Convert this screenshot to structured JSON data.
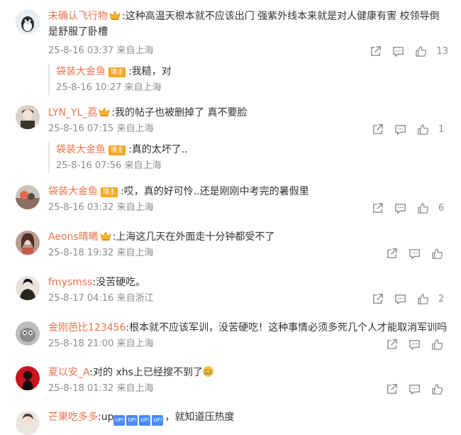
{
  "comments": [
    {
      "username": "未确认飞行物",
      "text": ":这种高温天根本就不应该出门 强紫外线本来就是对人健康有害 校领导倒是舒服了卧槽",
      "meta": "25-8-16 03:37 来自上海",
      "likes": "13",
      "reply": {
        "username": "袋装大金鱼",
        "tag": "博主",
        "text": ":我糙，对",
        "meta": "25-8-16 10:27 来自上海"
      }
    },
    {
      "username": "LYN_YL_荔",
      "text": ":我的帖子也被删掉了 真不要脸",
      "meta": "25-8-16 07:15 来自上海",
      "likes": "1",
      "reply": {
        "username": "袋装大金鱼",
        "tag": "博主",
        "text": ":真的太坏了..",
        "meta": "25-8-16 07:56 来自上海"
      }
    },
    {
      "username": "袋装大金鱼",
      "tag": "博主",
      "text": ":哎，真的好可怜..还是刚刚中考完的暑假里",
      "meta": "25-8-16 03:32 来自上海",
      "likes": "6"
    },
    {
      "username": "Aeons晴曦",
      "text": ":上海这几天在外面走十分钟都受不了",
      "meta": "25-8-18 19:32 来自上海",
      "likes": ""
    },
    {
      "username": "fmysmss",
      "text": ":没苦硬吃。",
      "meta": "25-8-17 04:16 来自浙江",
      "likes": "2"
    },
    {
      "username": "金刚芭比123456",
      "text": ":根本就不应该军训，没苦硬吃！这种事情必须多死几个人才能取消军训吗",
      "meta": "25-8-18 21:00 来自上海",
      "likes": ""
    },
    {
      "username": "夏以安_A",
      "text": ":对的 xhs上已经搜不到了",
      "meta": "25-8-18 01:32 来自上海",
      "likes": ""
    },
    {
      "username": "芒果吃多多",
      "text_prefix": ":up",
      "emoticons": [
        "UP!",
        "UP!",
        "UP!",
        "UP!"
      ],
      "text_suffix": "，就知道压热度",
      "meta": "",
      "likes": ""
    }
  ],
  "colors": {
    "username": "#eb7350",
    "meta": "#8d8d8d",
    "icon": "#8d8d8d",
    "tag": "#f5a623"
  },
  "icons": [
    "share-icon",
    "comment-icon",
    "like-icon",
    "crown-icon",
    "crying-emoji-icon"
  ]
}
